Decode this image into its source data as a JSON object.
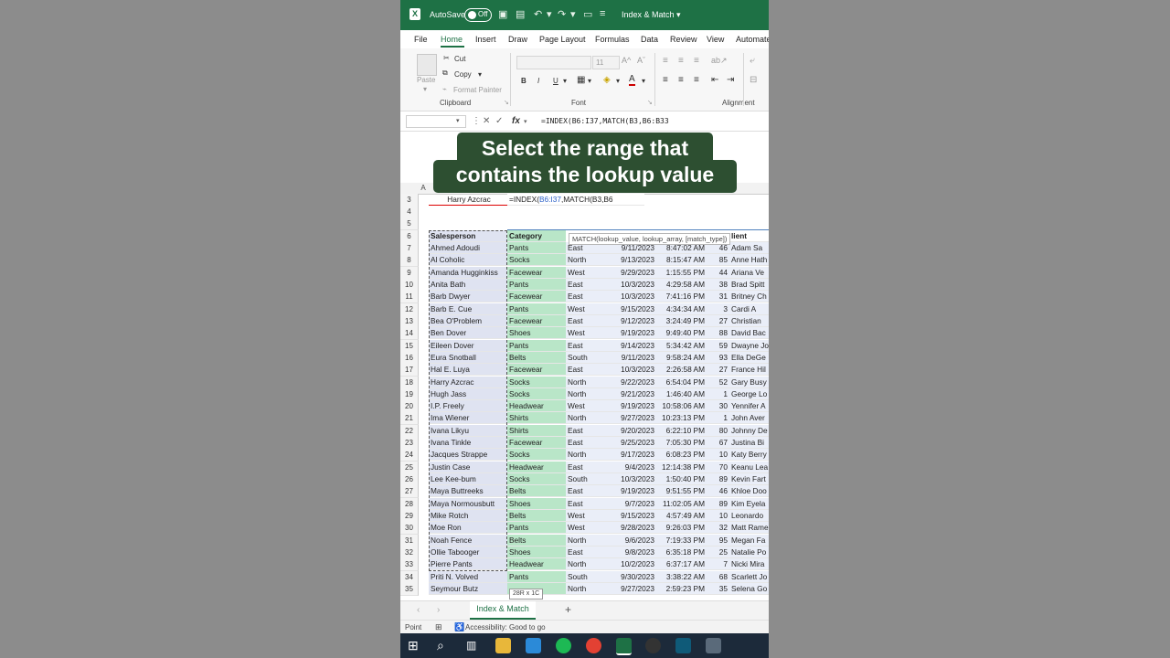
{
  "titlebar": {
    "autosave_label": "AutoSave",
    "toggle_state": "Off",
    "document_name": "Index & Match"
  },
  "menu": {
    "tabs": [
      "File",
      "Home",
      "Insert",
      "Draw",
      "Page Layout",
      "Formulas",
      "Data",
      "Review",
      "View",
      "Automate"
    ],
    "active": "Home"
  },
  "ribbon": {
    "paste": "Paste",
    "cut": "Cut",
    "copy": "Copy",
    "format_painter": "Format Painter",
    "clipboard": "Clipboard",
    "font_size": "11",
    "bold": "B",
    "italic": "I",
    "underline": "U",
    "font": "Font",
    "alignment": "Alignment"
  },
  "formula_bar": {
    "formula": "=INDEX(B6:I37,MATCH(B3,B6:B33"
  },
  "overlay": {
    "line1": "Select the range that",
    "line2": "contains the lookup value"
  },
  "grid": {
    "col_a": "A",
    "row3": {
      "num": "3",
      "name": "Harry Azcrac",
      "formula_a": "=INDEX(",
      "formula_b": "B6:I37",
      "formula_c": ",MATCH(B3,B6"
    },
    "row4": "4",
    "row5": "5",
    "headers": {
      "num": "6",
      "salesperson": "Salesperson",
      "category": "Category",
      "client": "lient"
    },
    "tooltip": "MATCH(lookup_value, lookup_array, [match_type])",
    "size_tip": "28R x 1C",
    "rows": [
      {
        "r": "7",
        "s": "Ahmed Adoudi",
        "c": "Pants",
        "g": "East",
        "d": "9/11/2023",
        "t": "8:47:02 AM",
        "n": "46",
        "cl": "Adam Sa"
      },
      {
        "r": "8",
        "s": "Al Coholic",
        "c": "Socks",
        "g": "North",
        "d": "9/13/2023",
        "t": "8:15:47 AM",
        "n": "85",
        "cl": "Anne Hath"
      },
      {
        "r": "9",
        "s": "Amanda Hugginkiss",
        "c": "Facewear",
        "g": "West",
        "d": "9/29/2023",
        "t": "1:15:55 PM",
        "n": "44",
        "cl": "Ariana Ve"
      },
      {
        "r": "10",
        "s": "Anita Bath",
        "c": "Pants",
        "g": "East",
        "d": "10/3/2023",
        "t": "4:29:58 AM",
        "n": "38",
        "cl": "Brad Spitt"
      },
      {
        "r": "11",
        "s": "Barb Dwyer",
        "c": "Facewear",
        "g": "East",
        "d": "10/3/2023",
        "t": "7:41:16 PM",
        "n": "31",
        "cl": "Britney Ch"
      },
      {
        "r": "12",
        "s": "Barb E. Cue",
        "c": "Pants",
        "g": "West",
        "d": "9/15/2023",
        "t": "4:34:34 AM",
        "n": "3",
        "cl": "Cardi A"
      },
      {
        "r": "13",
        "s": "Bea O'Problem",
        "c": "Facewear",
        "g": "East",
        "d": "9/12/2023",
        "t": "3:24:49 PM",
        "n": "27",
        "cl": "Christian"
      },
      {
        "r": "14",
        "s": "Ben Dover",
        "c": "Shoes",
        "g": "West",
        "d": "9/19/2023",
        "t": "9:49:40 PM",
        "n": "88",
        "cl": "David Bac"
      },
      {
        "r": "15",
        "s": "Eileen Dover",
        "c": "Pants",
        "g": "East",
        "d": "9/14/2023",
        "t": "5:34:42 AM",
        "n": "59",
        "cl": "Dwayne Jo"
      },
      {
        "r": "16",
        "s": "Eura Snotball",
        "c": "Belts",
        "g": "South",
        "d": "9/11/2023",
        "t": "9:58:24 AM",
        "n": "93",
        "cl": "Ella DeGe"
      },
      {
        "r": "17",
        "s": "Hal E. Luya",
        "c": "Facewear",
        "g": "East",
        "d": "10/3/2023",
        "t": "2:26:58 AM",
        "n": "27",
        "cl": "France Hil"
      },
      {
        "r": "18",
        "s": "Harry Azcrac",
        "c": "Socks",
        "g": "North",
        "d": "9/22/2023",
        "t": "6:54:04 PM",
        "n": "52",
        "cl": "Gary Busy"
      },
      {
        "r": "19",
        "s": "Hugh Jass",
        "c": "Socks",
        "g": "North",
        "d": "9/21/2023",
        "t": "1:46:40 AM",
        "n": "1",
        "cl": "George Lo"
      },
      {
        "r": "20",
        "s": "I.P. Freely",
        "c": "Headwear",
        "g": "West",
        "d": "9/19/2023",
        "t": "10:58:06 AM",
        "n": "30",
        "cl": "Yennifer A"
      },
      {
        "r": "21",
        "s": "Ima Wiener",
        "c": "Shirts",
        "g": "North",
        "d": "9/27/2023",
        "t": "10:23:13 PM",
        "n": "1",
        "cl": "John Aver"
      },
      {
        "r": "22",
        "s": "Ivana Likyu",
        "c": "Shirts",
        "g": "East",
        "d": "9/20/2023",
        "t": "6:22:10 PM",
        "n": "80",
        "cl": "Johnny De"
      },
      {
        "r": "23",
        "s": "Ivana Tinkle",
        "c": "Facewear",
        "g": "East",
        "d": "9/25/2023",
        "t": "7:05:30 PM",
        "n": "67",
        "cl": "Justina Bi"
      },
      {
        "r": "24",
        "s": "Jacques Strappe",
        "c": "Socks",
        "g": "North",
        "d": "9/17/2023",
        "t": "6:08:23 PM",
        "n": "10",
        "cl": "Katy Berry"
      },
      {
        "r": "25",
        "s": "Justin Case",
        "c": "Headwear",
        "g": "East",
        "d": "9/4/2023",
        "t": "12:14:38 PM",
        "n": "70",
        "cl": "Keanu Lea"
      },
      {
        "r": "26",
        "s": "Lee Kee-bum",
        "c": "Socks",
        "g": "South",
        "d": "10/3/2023",
        "t": "1:50:40 PM",
        "n": "89",
        "cl": "Kevin Fart"
      },
      {
        "r": "27",
        "s": "Maya Buttreeks",
        "c": "Belts",
        "g": "East",
        "d": "9/19/2023",
        "t": "9:51:55 PM",
        "n": "46",
        "cl": "Khloe Doo"
      },
      {
        "r": "28",
        "s": "Maya Normousbutt",
        "c": "Shoes",
        "g": "East",
        "d": "9/7/2023",
        "t": "11:02:05 AM",
        "n": "89",
        "cl": "Kim Eyela"
      },
      {
        "r": "29",
        "s": "Mike Rotch",
        "c": "Belts",
        "g": "West",
        "d": "9/15/2023",
        "t": "4:57:49 AM",
        "n": "10",
        "cl": "Leonardo"
      },
      {
        "r": "30",
        "s": "Moe Ron",
        "c": "Pants",
        "g": "West",
        "d": "9/28/2023",
        "t": "9:26:03 PM",
        "n": "32",
        "cl": "Matt Rame"
      },
      {
        "r": "31",
        "s": "Noah Fence",
        "c": "Belts",
        "g": "North",
        "d": "9/6/2023",
        "t": "7:19:33 PM",
        "n": "95",
        "cl": "Megan Fa"
      },
      {
        "r": "32",
        "s": "Ollie Tabooger",
        "c": "Shoes",
        "g": "East",
        "d": "9/8/2023",
        "t": "6:35:18 PM",
        "n": "25",
        "cl": "Natalie Po"
      },
      {
        "r": "33",
        "s": "Pierre Pants",
        "c": "Headwear",
        "g": "North",
        "d": "10/2/2023",
        "t": "6:37:17 AM",
        "n": "7",
        "cl": "Nicki Mira"
      },
      {
        "r": "34",
        "s": "Priti N. Volved",
        "c": "Pants",
        "g": "South",
        "d": "9/30/2023",
        "t": "3:38:22 AM",
        "n": "68",
        "cl": "Scarlett Jo"
      },
      {
        "r": "35",
        "s": "Seymour Butz",
        "c": "",
        "g": "North",
        "d": "9/27/2023",
        "t": "2:59:23 PM",
        "n": "35",
        "cl": "Selena Go"
      }
    ]
  },
  "sheet_tab": "Index & Match",
  "status": {
    "mode": "Point",
    "accessibility": "Accessibility: Good to go"
  },
  "colors": {
    "excel_green": "#1e7145",
    "category_fill": "#b9e6c8",
    "banner": "#2d4f31"
  }
}
